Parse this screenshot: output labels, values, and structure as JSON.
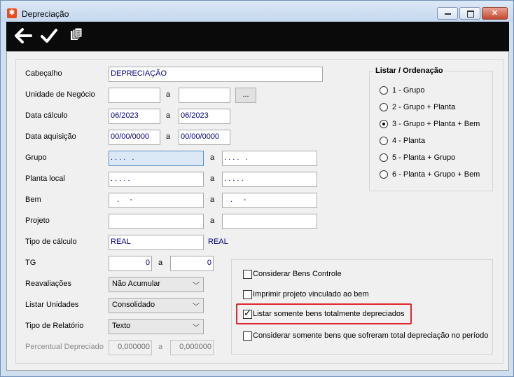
{
  "window": {
    "title": "Depreciação",
    "app_icon": "app-logo-icon",
    "minimize": "—",
    "maximize": "▢",
    "close": "✕"
  },
  "toolbar": {
    "back_icon": "arrow-left-icon",
    "confirm_icon": "checkmark-icon",
    "copy_icon": "copy-documents-icon"
  },
  "form": {
    "cabecalho": {
      "label": "Cabeçalho",
      "value": "DEPRECIAÇÃO"
    },
    "unidade": {
      "label": "Unidade de Negócio",
      "from": "",
      "sep": "a",
      "to": "",
      "button": "..."
    },
    "data_calculo": {
      "label": "Data cálculo",
      "from": "06/2023",
      "sep": "a",
      "to": "06/2023"
    },
    "data_aquisicao": {
      "label": "Data aquisição",
      "from": "00/00/0000",
      "sep": "a",
      "to": "00/00/0000"
    },
    "grupo": {
      "label": "Grupo",
      "from": ". . . .   .",
      "sep": "a",
      "to": ". . . .   ."
    },
    "planta": {
      "label": "Planta local",
      "from": ". . . . .",
      "sep": "a",
      "to": ". . . . ."
    },
    "bem": {
      "label": "Bem",
      "from": "   .     -",
      "sep": "a",
      "to": "   .     -"
    },
    "projeto": {
      "label": "Projeto",
      "from": "",
      "sep": "a",
      "to": ""
    },
    "tipo_calculo": {
      "label": "Tipo de cálculo",
      "value": "REAL",
      "display": "REAL"
    },
    "tg": {
      "label": "TG",
      "from": "0",
      "sep": "a",
      "to": "0"
    },
    "reavaliacoes": {
      "label": "Reavaliações",
      "value": "Não Acumular"
    },
    "listar_unidades": {
      "label": "Listar Unidades",
      "value": "Consolidado"
    },
    "tipo_relatorio": {
      "label": "Tipo de Relatório",
      "value": "Texto"
    },
    "percentual": {
      "label": "Percentual Depreciado",
      "from": "0,000000",
      "sep": "a",
      "to": "0,000000"
    }
  },
  "ordenacao": {
    "legend": "Listar / Ordenação",
    "options": [
      {
        "label": "1 - Grupo",
        "selected": false
      },
      {
        "label": "2 - Grupo + Planta",
        "selected": false
      },
      {
        "label": "3 - Grupo + Planta + Bem",
        "selected": true
      },
      {
        "label": "4 - Planta",
        "selected": false
      },
      {
        "label": "5 - Planta + Grupo",
        "selected": false
      },
      {
        "label": "6 - Planta + Grupo + Bem",
        "selected": false
      }
    ]
  },
  "checkboxes": [
    {
      "label": "Considerar Bens Controle",
      "checked": false
    },
    {
      "label": "Imprimir projeto vinculado ao bem",
      "checked": false
    },
    {
      "label": "Listar somente bens totalmente depreciados",
      "checked": true
    },
    {
      "label": "Considerar somente bens que sofreram total depreciação no período",
      "checked": false
    }
  ],
  "colors": {
    "highlight": "#e0262c",
    "input_text": "#000080",
    "toolbar": "#0a0a0a"
  }
}
